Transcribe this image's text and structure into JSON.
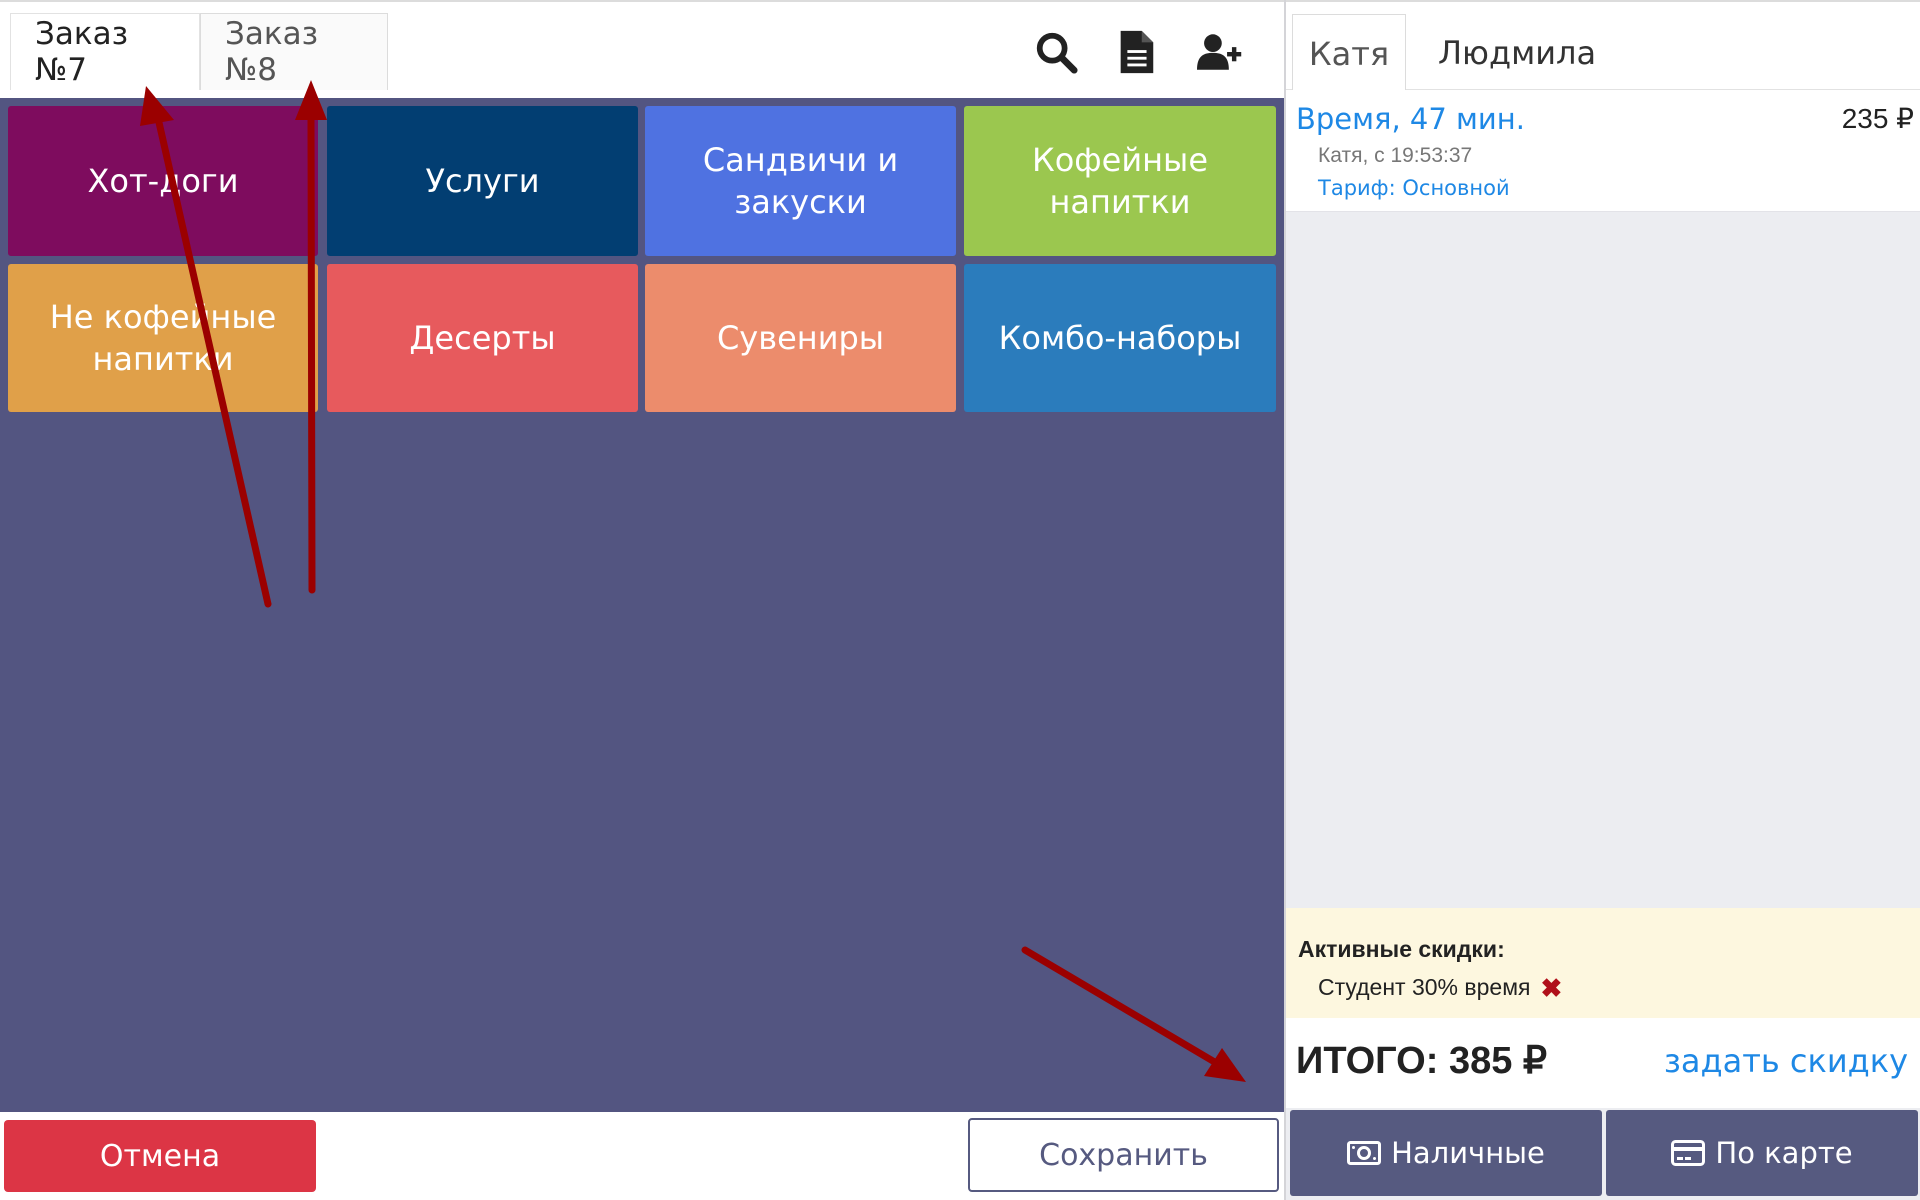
{
  "orders": {
    "tabs": [
      {
        "label": "Заказ №7"
      },
      {
        "label": "Заказ №8"
      }
    ],
    "icons": [
      "search-icon",
      "document-icon",
      "add-user-icon"
    ]
  },
  "categories": [
    {
      "label": "Хот-доги",
      "color": "#7e0c5e"
    },
    {
      "label": "Услуги",
      "color": "#023e72"
    },
    {
      "label": "Сандвичи и закуски",
      "color": "#4f72e1"
    },
    {
      "label": "Кофейные напитки",
      "color": "#9bc74f"
    },
    {
      "label": "Не кофейные напитки",
      "color": "#e0a049"
    },
    {
      "label": "Десерты",
      "color": "#e75a5d"
    },
    {
      "label": "Сувениры",
      "color": "#ec8c6c"
    },
    {
      "label": "Комбо-наборы",
      "color": "#2b7cbc"
    }
  ],
  "actions": {
    "cancel_label": "Отмена",
    "save_label": "Сохранить"
  },
  "staff": {
    "tabs": [
      {
        "label": "Катя"
      },
      {
        "label": "Людмила"
      }
    ]
  },
  "cart": {
    "item": {
      "title": "Время, 47 мин.",
      "price": "235 ₽",
      "subtitle": "Катя, с 19:53:37",
      "tariff": "Тариф: Основной"
    },
    "discounts_title": "Активные скидки:",
    "discount_item": "Студент 30% время",
    "total": "ИТОГО: 385 ₽",
    "set_discount_label": "задать скидку",
    "cash_label": "Наличные",
    "card_label": "По карте"
  },
  "colors": {
    "grid_bg": "#535581",
    "pay_button": "#565a80",
    "cancel": "#dc3545",
    "link": "#1e88e5",
    "annotation_arrow": "#9b0000"
  }
}
